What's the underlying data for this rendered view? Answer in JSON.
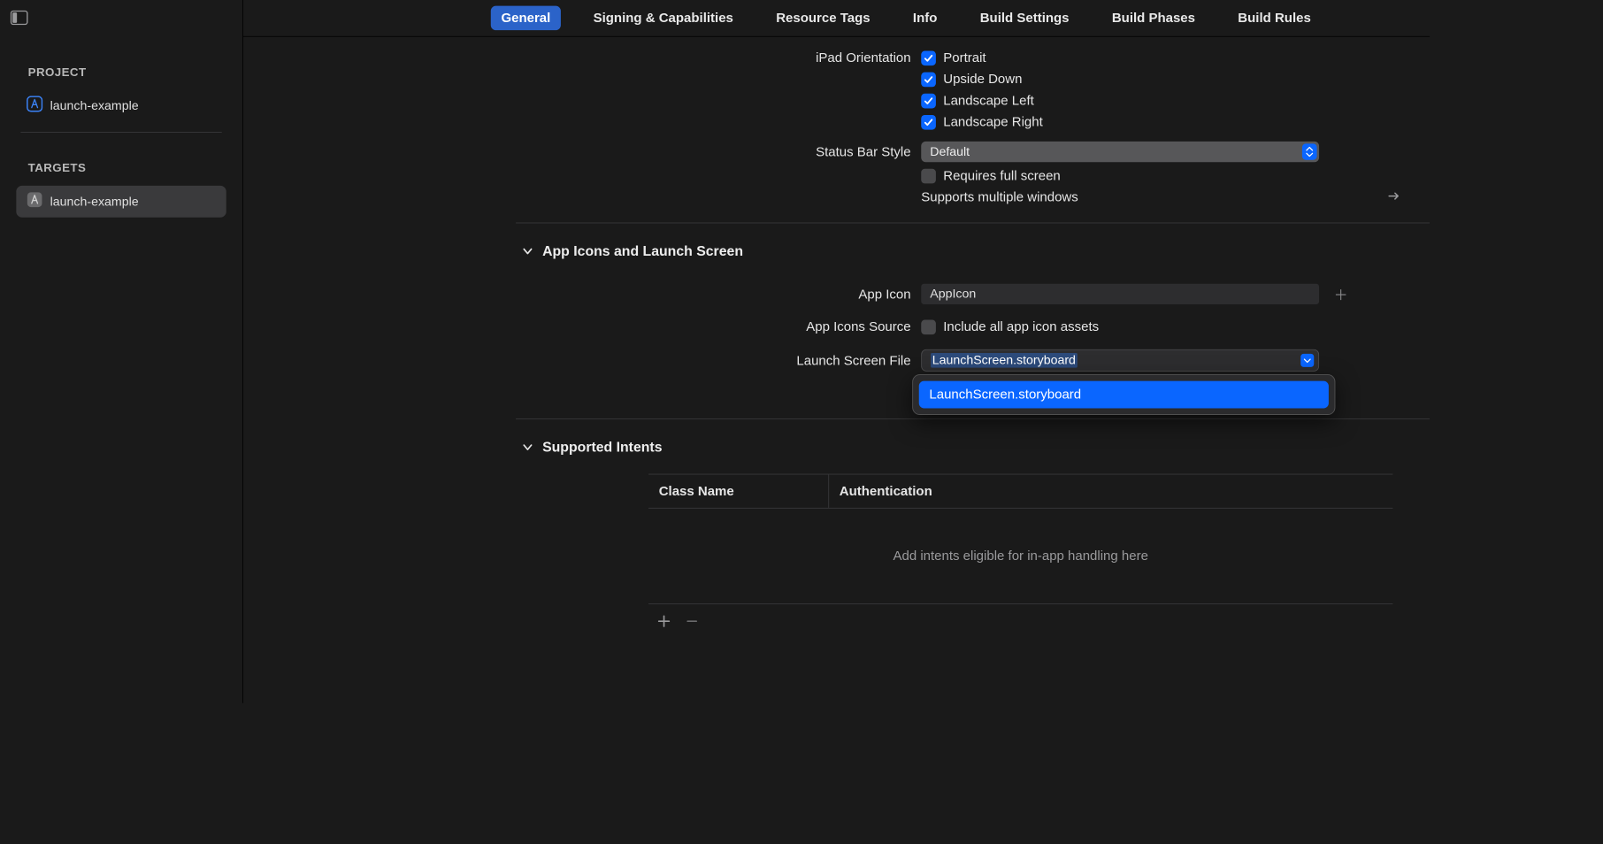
{
  "sidebar": {
    "projectHeader": "PROJECT",
    "targetsHeader": "TARGETS",
    "projectItem": "launch-example",
    "targetItem": "launch-example"
  },
  "tabs": [
    "General",
    "Signing & Capabilities",
    "Resource Tags",
    "Info",
    "Build Settings",
    "Build Phases",
    "Build Rules"
  ],
  "orientation": {
    "label": "iPad Orientation",
    "items": [
      "Portrait",
      "Upside Down",
      "Landscape Left",
      "Landscape Right"
    ]
  },
  "statusBar": {
    "label": "Status Bar Style",
    "value": "Default",
    "requiresFullScreenLabel": "Requires full screen",
    "supportsMultipleLabel": "Supports multiple windows"
  },
  "iconsSection": {
    "title": "App Icons and Launch Screen",
    "appIconLabel": "App Icon",
    "appIconValue": "AppIcon",
    "appIconsSourceLabel": "App Icons Source",
    "includeAllLabel": "Include all app icon assets",
    "launchScreenLabel": "Launch Screen File",
    "launchScreenValue": "LaunchScreen.storyboard",
    "dropdownOption": "LaunchScreen.storyboard"
  },
  "intentsSection": {
    "title": "Supported Intents",
    "col1": "Class Name",
    "col2": "Authentication",
    "placeholder": "Add intents eligible for in-app handling here"
  }
}
